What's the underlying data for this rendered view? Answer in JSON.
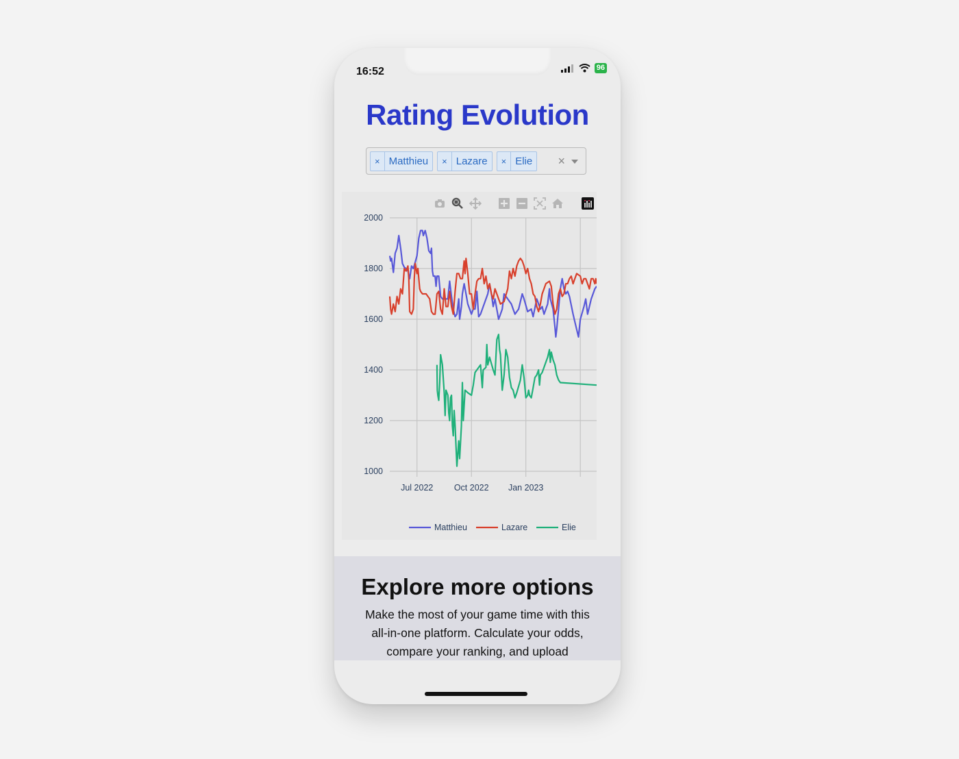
{
  "status_bar": {
    "time": "16:52",
    "battery": "96",
    "signal_icon": "cellular-signal-icon",
    "wifi_icon": "wifi-icon",
    "battery_icon": "battery-charging-icon"
  },
  "page": {
    "title": "Rating Evolution"
  },
  "player_select": {
    "selected": [
      {
        "label": "Matthieu",
        "remove": "×"
      },
      {
        "label": "Lazare",
        "remove": "×"
      },
      {
        "label": "Elie",
        "remove": "×"
      }
    ],
    "clear": "×"
  },
  "modebar": [
    "camera-icon",
    "zoom-icon",
    "pan-icon",
    "zoom-in-icon",
    "zoom-out-icon",
    "autoscale-icon",
    "reset-axes-icon",
    "plotly-logo-icon"
  ],
  "colors": {
    "title": "#2a38c9",
    "Matthieu": "#5858d8",
    "Lazare": "#d8402c",
    "Elie": "#1fb07a"
  },
  "chart_data": {
    "type": "line",
    "title": "",
    "xlabel": "",
    "ylabel": "",
    "ylim": [
      1000,
      2000
    ],
    "yticks": [
      "1000",
      "1200",
      "1400",
      "1600",
      "1800",
      "2000"
    ],
    "ytick_values": [
      1000,
      1200,
      1400,
      1600,
      1800,
      2000
    ],
    "xticks": [
      "Jul 2022",
      "Oct 2022",
      "Jan 2023"
    ],
    "xtick_values": [
      0,
      3,
      6
    ],
    "x_unit": "months since Jul 2022",
    "xlim": [
      -1.5,
      9.9
    ],
    "grid": true,
    "legend_position": "bottom",
    "series": [
      {
        "name": "Matthieu",
        "points": [
          [
            -1.5,
            1850
          ],
          [
            -1.45,
            1830
          ],
          [
            -1.4,
            1840
          ],
          [
            -1.3,
            1785
          ],
          [
            -1.2,
            1860
          ],
          [
            -1.1,
            1880
          ],
          [
            -1.0,
            1930
          ],
          [
            -0.9,
            1880
          ],
          [
            -0.8,
            1820
          ],
          [
            -0.7,
            1805
          ],
          [
            -0.6,
            1800
          ],
          [
            -0.5,
            1790
          ],
          [
            -0.4,
            1760
          ],
          [
            -0.3,
            1810
          ],
          [
            -0.2,
            1800
          ],
          [
            -0.1,
            1825
          ],
          [
            0.0,
            1850
          ],
          [
            0.1,
            1920
          ],
          [
            0.2,
            1950
          ],
          [
            0.3,
            1950
          ],
          [
            0.35,
            1930
          ],
          [
            0.45,
            1950
          ],
          [
            0.55,
            1920
          ],
          [
            0.65,
            1870
          ],
          [
            0.75,
            1860
          ],
          [
            0.8,
            1880
          ],
          [
            0.85,
            1790
          ],
          [
            0.9,
            1770
          ],
          [
            1.0,
            1770
          ],
          [
            1.05,
            1730
          ],
          [
            1.1,
            1770
          ],
          [
            1.2,
            1770
          ],
          [
            1.3,
            1690
          ],
          [
            1.4,
            1680
          ],
          [
            1.7,
            1680
          ],
          [
            1.8,
            1750
          ],
          [
            1.9,
            1690
          ],
          [
            2.0,
            1640
          ],
          [
            2.1,
            1610
          ],
          [
            2.2,
            1620
          ],
          [
            2.3,
            1680
          ],
          [
            2.35,
            1600
          ],
          [
            2.45,
            1650
          ],
          [
            2.5,
            1700
          ],
          [
            2.6,
            1740
          ],
          [
            2.7,
            1700
          ],
          [
            2.8,
            1660
          ],
          [
            2.9,
            1640
          ],
          [
            3.0,
            1620
          ],
          [
            3.1,
            1640
          ],
          [
            3.2,
            1640
          ],
          [
            3.3,
            1710
          ],
          [
            3.4,
            1610
          ],
          [
            3.5,
            1620
          ],
          [
            3.7,
            1660
          ],
          [
            3.9,
            1700
          ],
          [
            4.0,
            1740
          ],
          [
            4.1,
            1700
          ],
          [
            4.2,
            1650
          ],
          [
            4.3,
            1680
          ],
          [
            4.5,
            1600
          ],
          [
            4.6,
            1620
          ],
          [
            4.7,
            1640
          ],
          [
            4.8,
            1700
          ],
          [
            5.0,
            1680
          ],
          [
            5.2,
            1660
          ],
          [
            5.3,
            1640
          ],
          [
            5.4,
            1620
          ],
          [
            5.6,
            1640
          ],
          [
            5.8,
            1700
          ],
          [
            5.9,
            1680
          ],
          [
            6.1,
            1630
          ],
          [
            6.3,
            1640
          ],
          [
            6.4,
            1610
          ],
          [
            6.6,
            1680
          ],
          [
            6.8,
            1640
          ],
          [
            6.9,
            1650
          ],
          [
            7.0,
            1620
          ],
          [
            7.2,
            1660
          ],
          [
            7.3,
            1720
          ],
          [
            7.35,
            1680
          ],
          [
            7.5,
            1640
          ],
          [
            7.6,
            1570
          ],
          [
            7.65,
            1530
          ],
          [
            7.7,
            1560
          ],
          [
            7.8,
            1640
          ],
          [
            7.9,
            1720
          ],
          [
            8.0,
            1760
          ],
          [
            8.1,
            1720
          ],
          [
            8.2,
            1700
          ],
          [
            8.3,
            1710
          ],
          [
            8.4,
            1690
          ],
          [
            8.6,
            1620
          ],
          [
            8.7,
            1590
          ],
          [
            8.9,
            1530
          ],
          [
            9.0,
            1600
          ],
          [
            9.2,
            1650
          ],
          [
            9.3,
            1680
          ],
          [
            9.4,
            1620
          ],
          [
            9.6,
            1680
          ],
          [
            9.8,
            1720
          ],
          [
            9.9,
            1730
          ]
        ]
      },
      {
        "name": "Lazare",
        "points": [
          [
            -1.5,
            1690
          ],
          [
            -1.45,
            1640
          ],
          [
            -1.4,
            1620
          ],
          [
            -1.3,
            1660
          ],
          [
            -1.2,
            1630
          ],
          [
            -1.1,
            1690
          ],
          [
            -1.0,
            1660
          ],
          [
            -0.9,
            1720
          ],
          [
            -0.8,
            1700
          ],
          [
            -0.7,
            1800
          ],
          [
            -0.6,
            1790
          ],
          [
            -0.5,
            1810
          ],
          [
            -0.45,
            1760
          ],
          [
            -0.4,
            1630
          ],
          [
            -0.3,
            1620
          ],
          [
            -0.2,
            1640
          ],
          [
            -0.15,
            1760
          ],
          [
            -0.1,
            1820
          ],
          [
            0.0,
            1780
          ],
          [
            0.05,
            1800
          ],
          [
            0.1,
            1760
          ],
          [
            0.15,
            1720
          ],
          [
            0.2,
            1710
          ],
          [
            0.3,
            1700
          ],
          [
            0.5,
            1700
          ],
          [
            0.7,
            1680
          ],
          [
            0.8,
            1630
          ],
          [
            0.9,
            1620
          ],
          [
            1.0,
            1620
          ],
          [
            1.1,
            1700
          ],
          [
            1.2,
            1710
          ],
          [
            1.3,
            1640
          ],
          [
            1.4,
            1620
          ],
          [
            1.5,
            1720
          ],
          [
            1.6,
            1650
          ],
          [
            1.7,
            1650
          ],
          [
            1.8,
            1710
          ],
          [
            1.9,
            1650
          ],
          [
            2.0,
            1620
          ],
          [
            2.1,
            1710
          ],
          [
            2.2,
            1780
          ],
          [
            2.3,
            1780
          ],
          [
            2.4,
            1760
          ],
          [
            2.5,
            1760
          ],
          [
            2.6,
            1830
          ],
          [
            2.65,
            1780
          ],
          [
            2.7,
            1840
          ],
          [
            2.8,
            1780
          ],
          [
            2.9,
            1700
          ],
          [
            3.0,
            1700
          ],
          [
            3.1,
            1640
          ],
          [
            3.2,
            1700
          ],
          [
            3.3,
            1750
          ],
          [
            3.4,
            1760
          ],
          [
            3.5,
            1760
          ],
          [
            3.6,
            1800
          ],
          [
            3.7,
            1740
          ],
          [
            3.8,
            1770
          ],
          [
            3.9,
            1720
          ],
          [
            4.0,
            1740
          ],
          [
            4.1,
            1700
          ],
          [
            4.2,
            1680
          ],
          [
            4.3,
            1720
          ],
          [
            4.4,
            1700
          ],
          [
            4.6,
            1660
          ],
          [
            4.8,
            1670
          ],
          [
            5.0,
            1720
          ],
          [
            5.1,
            1790
          ],
          [
            5.2,
            1760
          ],
          [
            5.3,
            1800
          ],
          [
            5.4,
            1770
          ],
          [
            5.5,
            1810
          ],
          [
            5.6,
            1830
          ],
          [
            5.7,
            1840
          ],
          [
            5.8,
            1830
          ],
          [
            5.9,
            1810
          ],
          [
            6.0,
            1780
          ],
          [
            6.1,
            1800
          ],
          [
            6.2,
            1760
          ],
          [
            6.3,
            1740
          ],
          [
            6.4,
            1700
          ],
          [
            6.5,
            1690
          ],
          [
            6.6,
            1650
          ],
          [
            6.7,
            1630
          ],
          [
            6.8,
            1660
          ],
          [
            6.9,
            1700
          ],
          [
            7.0,
            1720
          ],
          [
            7.1,
            1740
          ],
          [
            7.3,
            1750
          ],
          [
            7.4,
            1730
          ],
          [
            7.5,
            1660
          ],
          [
            7.6,
            1620
          ],
          [
            7.7,
            1640
          ],
          [
            7.8,
            1700
          ],
          [
            7.9,
            1720
          ],
          [
            8.0,
            1690
          ],
          [
            8.1,
            1700
          ],
          [
            8.2,
            1740
          ],
          [
            8.3,
            1740
          ],
          [
            8.4,
            1760
          ],
          [
            8.5,
            1770
          ],
          [
            8.6,
            1740
          ],
          [
            8.7,
            1760
          ],
          [
            8.8,
            1780
          ],
          [
            9.0,
            1770
          ],
          [
            9.1,
            1740
          ],
          [
            9.2,
            1760
          ],
          [
            9.3,
            1760
          ],
          [
            9.5,
            1720
          ],
          [
            9.6,
            1760
          ],
          [
            9.7,
            1760
          ],
          [
            9.8,
            1740
          ],
          [
            9.85,
            1760
          ],
          [
            9.9,
            1740
          ]
        ]
      },
      {
        "name": "Elie",
        "points": [
          [
            1.1,
            1420
          ],
          [
            1.12,
            1320
          ],
          [
            1.15,
            1300
          ],
          [
            1.2,
            1280
          ],
          [
            1.25,
            1350
          ],
          [
            1.3,
            1460
          ],
          [
            1.4,
            1420
          ],
          [
            1.5,
            1310
          ],
          [
            1.55,
            1220
          ],
          [
            1.6,
            1320
          ],
          [
            1.7,
            1300
          ],
          [
            1.75,
            1230
          ],
          [
            1.8,
            1200
          ],
          [
            1.85,
            1290
          ],
          [
            1.9,
            1300
          ],
          [
            1.95,
            1180
          ],
          [
            2.0,
            1140
          ],
          [
            2.05,
            1240
          ],
          [
            2.1,
            1180
          ],
          [
            2.2,
            1020
          ],
          [
            2.3,
            1120
          ],
          [
            2.35,
            1050
          ],
          [
            2.45,
            1180
          ],
          [
            2.5,
            1350
          ],
          [
            2.55,
            1200
          ],
          [
            2.65,
            1320
          ],
          [
            2.8,
            1310
          ],
          [
            3.0,
            1300
          ],
          [
            3.1,
            1340
          ],
          [
            3.2,
            1390
          ],
          [
            3.3,
            1400
          ],
          [
            3.5,
            1420
          ],
          [
            3.6,
            1330
          ],
          [
            3.65,
            1400
          ],
          [
            3.8,
            1410
          ],
          [
            3.85,
            1500
          ],
          [
            3.9,
            1420
          ],
          [
            4.0,
            1450
          ],
          [
            4.2,
            1400
          ],
          [
            4.3,
            1380
          ],
          [
            4.4,
            1520
          ],
          [
            4.5,
            1540
          ],
          [
            4.55,
            1480
          ],
          [
            4.6,
            1460
          ],
          [
            4.7,
            1320
          ],
          [
            4.8,
            1380
          ],
          [
            4.9,
            1480
          ],
          [
            5.0,
            1450
          ],
          [
            5.1,
            1370
          ],
          [
            5.2,
            1330
          ],
          [
            5.3,
            1320
          ],
          [
            5.4,
            1290
          ],
          [
            5.5,
            1310
          ],
          [
            5.7,
            1360
          ],
          [
            5.8,
            1420
          ],
          [
            5.9,
            1370
          ],
          [
            6.0,
            1290
          ],
          [
            6.1,
            1300
          ],
          [
            6.15,
            1320
          ],
          [
            6.2,
            1300
          ],
          [
            6.3,
            1290
          ],
          [
            6.4,
            1330
          ],
          [
            6.5,
            1370
          ],
          [
            6.6,
            1380
          ],
          [
            6.7,
            1400
          ],
          [
            6.75,
            1340
          ],
          [
            6.8,
            1380
          ],
          [
            6.9,
            1390
          ],
          [
            7.0,
            1410
          ],
          [
            7.1,
            1430
          ],
          [
            7.2,
            1450
          ],
          [
            7.3,
            1480
          ],
          [
            7.35,
            1430
          ],
          [
            7.4,
            1470
          ],
          [
            7.5,
            1440
          ],
          [
            7.6,
            1420
          ],
          [
            7.7,
            1380
          ],
          [
            7.8,
            1360
          ],
          [
            7.9,
            1350
          ],
          [
            9.9,
            1340
          ]
        ]
      }
    ]
  },
  "legend": [
    "Matthieu",
    "Lazare",
    "Elie"
  ],
  "explore": {
    "heading": "Explore more options",
    "body": "Make the most of your game time with this all-in-one platform. Calculate your odds, compare your ranking, and upload"
  }
}
